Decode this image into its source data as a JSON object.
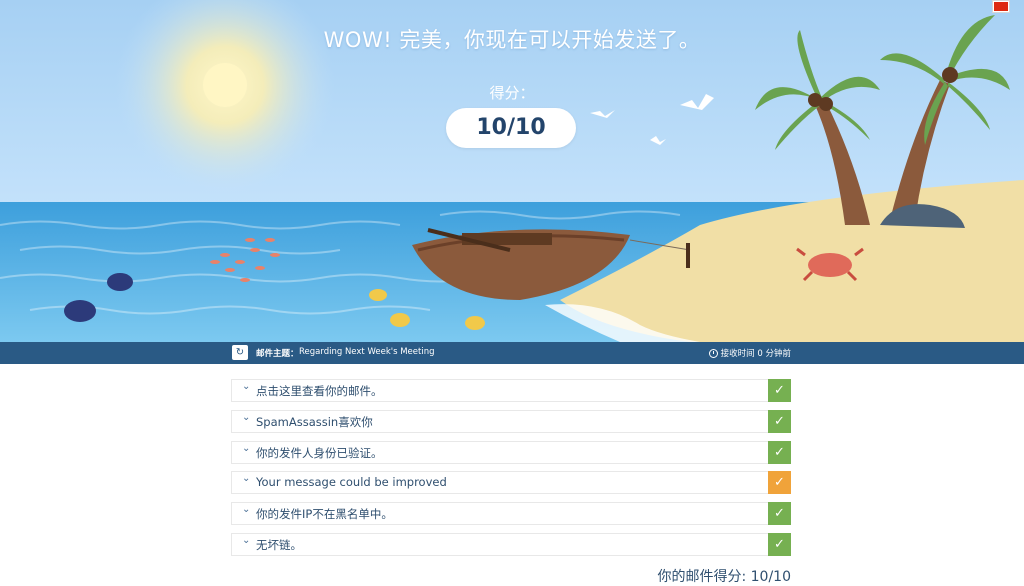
{
  "hero": {
    "headline": "WOW! 完美，你现在可以开始发送了。",
    "score_label": "得分：",
    "score_value": "10/10"
  },
  "language": {
    "flag_icon": "flag-cn-icon"
  },
  "infobar": {
    "refresh_icon": "refresh-icon",
    "subject_label": "邮件主题：",
    "subject_value": "Regarding Next Week's Meeting",
    "clock_icon": "clock-icon",
    "received": "接收时间 0 分钟前"
  },
  "checks": [
    {
      "label": "点击这里查看你的邮件。",
      "status": "ok",
      "icon": "check-icon"
    },
    {
      "label": "SpamAssassin喜欢你",
      "status": "ok",
      "icon": "check-icon"
    },
    {
      "label": "你的发件人身份已验证。",
      "status": "ok",
      "icon": "check-icon"
    },
    {
      "label": "Your message could be improved",
      "status": "warn",
      "icon": "check-icon"
    },
    {
      "label": "你的发件IP不在黑名单中。",
      "status": "ok",
      "icon": "check-icon"
    },
    {
      "label": "无坏链。",
      "status": "ok",
      "icon": "check-icon"
    }
  ],
  "footer": {
    "score_text": "你的邮件得分: 10/10"
  },
  "colors": {
    "sky": "#a9d3f5",
    "sea": "#4fb0e4",
    "sand": "#f1dfa6",
    "infobar": "#2a5a85",
    "ok": "#76b051",
    "warn": "#f0a33a",
    "text": "#2f4f6f"
  }
}
